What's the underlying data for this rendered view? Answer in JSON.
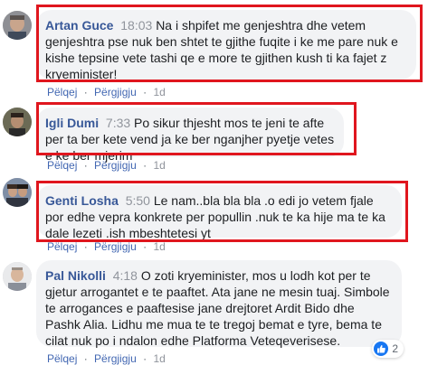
{
  "comments": [
    {
      "author": "Artan Guce",
      "time": "18:03",
      "text": "Na i shpifet me genjeshtra dhe vetem genjeshtra pse nuk ben shtet te gjithe fuqite i ke me pare nuk e kishe tepsine vete tashi qe e more te gjithen kush ti ka fajet z kryeminister!",
      "reply_label": "Pëlqej",
      "respond_label": "Përgjigju",
      "age": "1d"
    },
    {
      "author": "Igli Dumi",
      "time": "7:33",
      "text": "Po sikur thjesht mos te jeni te afte per ta ber kete vend ja ke ber nganjher pyetje vetes e ke ber mjerim",
      "reply_label": "Pëlqej",
      "respond_label": "Përgjigju",
      "age": "1d"
    },
    {
      "author": "Genti Losha",
      "time": "5:50",
      "text": "Le nam..bla bla bla .o edi jo vetem fjale por edhe vepra konkrete per popullin .nuk te ka hije ma te ka dale lezeti .ish mbeshtetesi yt",
      "reply_label": "Pëlqej",
      "respond_label": "Përgjigju",
      "age": "1d"
    },
    {
      "author": "Pal Nikolli",
      "time": "4:18",
      "text": "O zoti kryeminister, mos u lodh kot per te gjetur arrogantet e te paaftet. Ata jane ne mesin tuaj. Simbole te arrogances e paaftesise jane drejtoret Ardit Bido dhe Pashk Alia. Lidhu me mua te te tregoj bemat e tyre, bema te cilat nuk po i ndalon edhe Platforma Veteqeverisese.",
      "reply_label": "Pëlqej",
      "respond_label": "Përgjigju",
      "age": "1d",
      "reaction_count": "2"
    }
  ],
  "sep": "·",
  "colors": {
    "author": "#385898",
    "highlight": "#e0161e",
    "bubble": "#f2f3f5",
    "like": "#1877f2"
  },
  "icons": {
    "like": "thumbs-up-icon"
  }
}
